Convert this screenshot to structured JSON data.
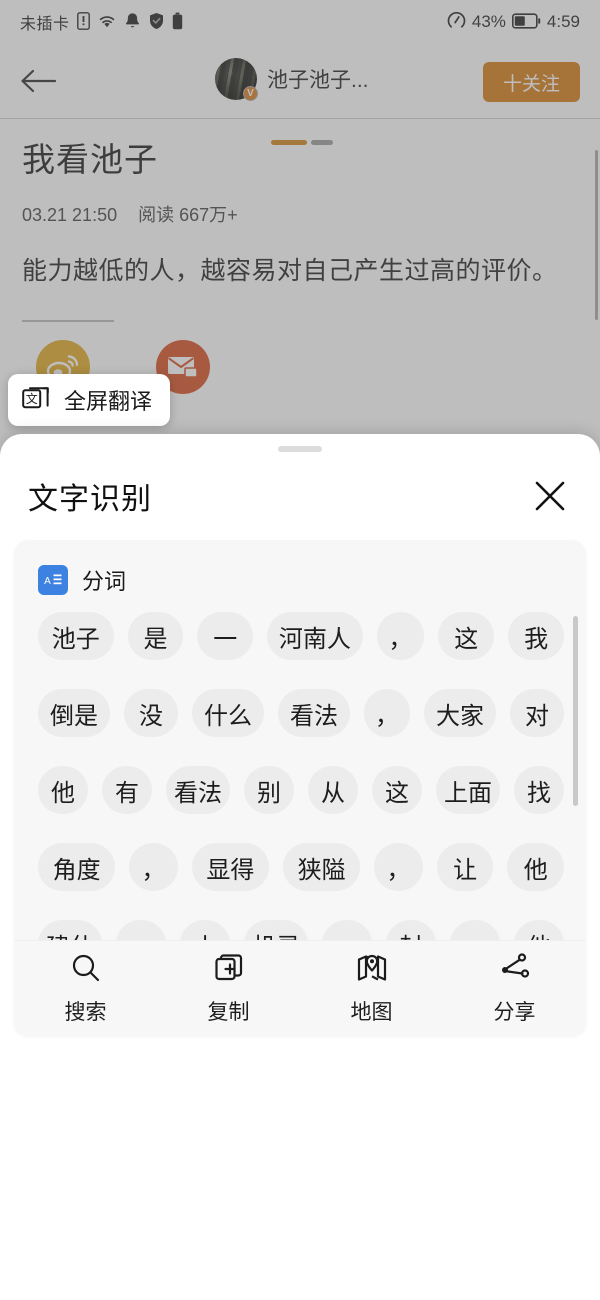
{
  "status_bar": {
    "carrier": "未插卡",
    "icons": [
      "sim-alert-icon",
      "wifi-icon",
      "notification-bell-icon",
      "shield-check-icon",
      "battery-saver-icon"
    ],
    "battery_percent": "43%",
    "time": "4:59"
  },
  "nav": {
    "back_icon": "back-arrow-icon",
    "account_name": "池子池子...",
    "verified_badge": "V",
    "follow_label": "十关注",
    "accent_color": "#d4770e"
  },
  "article": {
    "title": "我看池子",
    "date": "03.21 21:50",
    "read_count": "阅读 667万+",
    "body": "能力越低的人，越容易对自己产生过高的评价。",
    "share_icons": [
      "weibo-icon",
      "mail-icon"
    ],
    "weibo_color": "#dfa61c",
    "mail_color": "#d8491c"
  },
  "translate_chip": {
    "icon": "translate-icon",
    "label": "全屏翻译"
  },
  "sheet": {
    "title": "文字识别",
    "close_icon": "close-icon",
    "card": {
      "icon": "segmentation-icon",
      "label": "分词",
      "icon_color": "#3d82e0",
      "token_rows": [
        [
          "池子",
          "是",
          "一",
          "河南人",
          "，",
          "这",
          "我"
        ],
        [
          "倒是",
          "没",
          "什么",
          "看法",
          "，",
          "大家",
          "对"
        ],
        [
          "他",
          "有",
          "看法",
          "别",
          "从",
          "这",
          "上面",
          "找"
        ],
        [
          "角度",
          "，",
          "显得",
          "狭隘",
          "，",
          "让",
          "他"
        ],
        [
          "建仕",
          "",
          "小",
          "机灵",
          "一",
          "封",
          "",
          "他"
        ]
      ]
    },
    "toolbar": [
      {
        "icon": "search-icon",
        "label": "搜索"
      },
      {
        "icon": "copy-icon",
        "label": "复制"
      },
      {
        "icon": "map-icon",
        "label": "地图"
      },
      {
        "icon": "share-icon",
        "label": "分享"
      }
    ]
  }
}
